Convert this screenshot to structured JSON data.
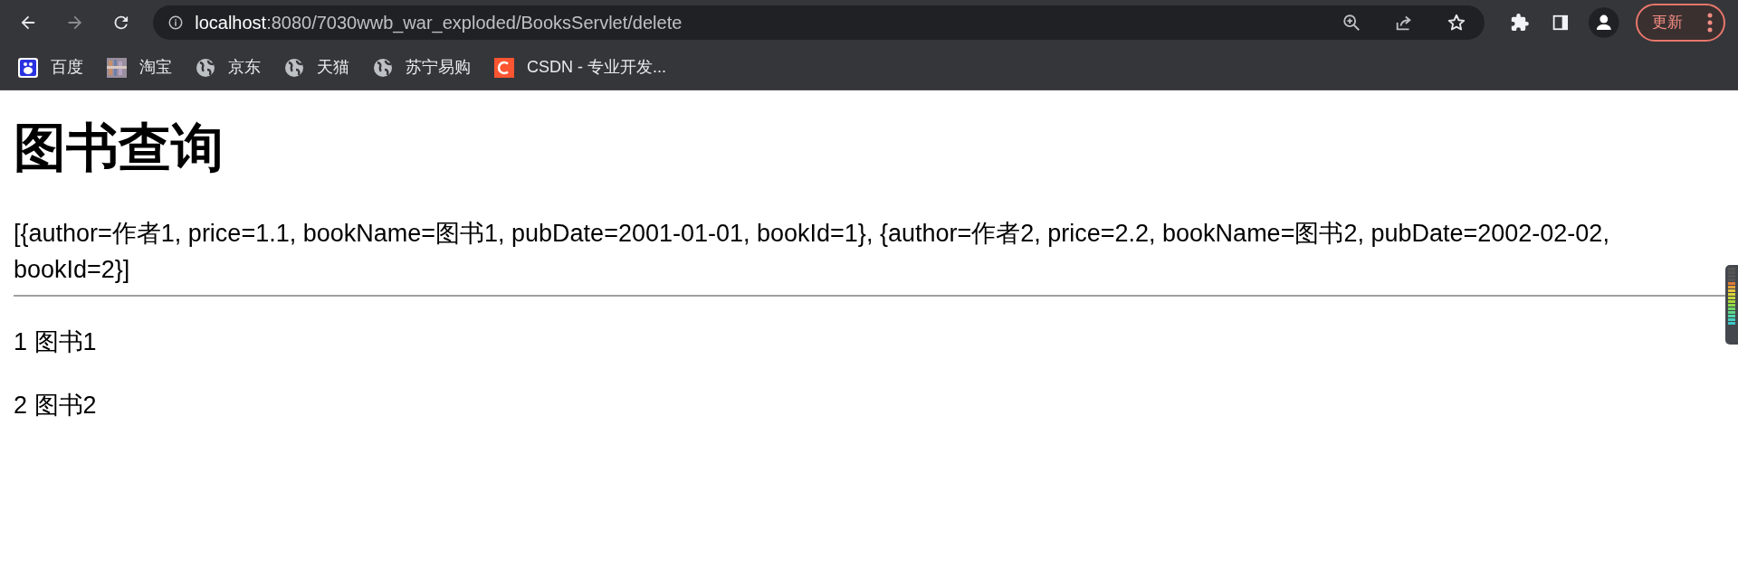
{
  "browser": {
    "url_host": "localhost",
    "url_rest": ":8080/7030wwb_war_exploded/BooksServlet/delete",
    "update_button": "更新"
  },
  "bookmarks": [
    {
      "label": "百度",
      "kind": "paw"
    },
    {
      "label": "淘宝",
      "kind": "mosaic"
    },
    {
      "label": "京东",
      "kind": "globe"
    },
    {
      "label": "天猫",
      "kind": "globe"
    },
    {
      "label": "苏宁易购",
      "kind": "globe"
    },
    {
      "label": "CSDN - 专业开发...",
      "kind": "letter-c"
    }
  ],
  "page": {
    "heading": "图书查询",
    "data_text": "[{author=作者1, price=1.1, bookName=图书1, pubDate=2001-01-01, bookId=1}, {author=作者2, price=2.2, bookName=图书2, pubDate=2002-02-02, bookId=2}]",
    "books": [
      "1 图书1",
      "2 图书2"
    ]
  }
}
